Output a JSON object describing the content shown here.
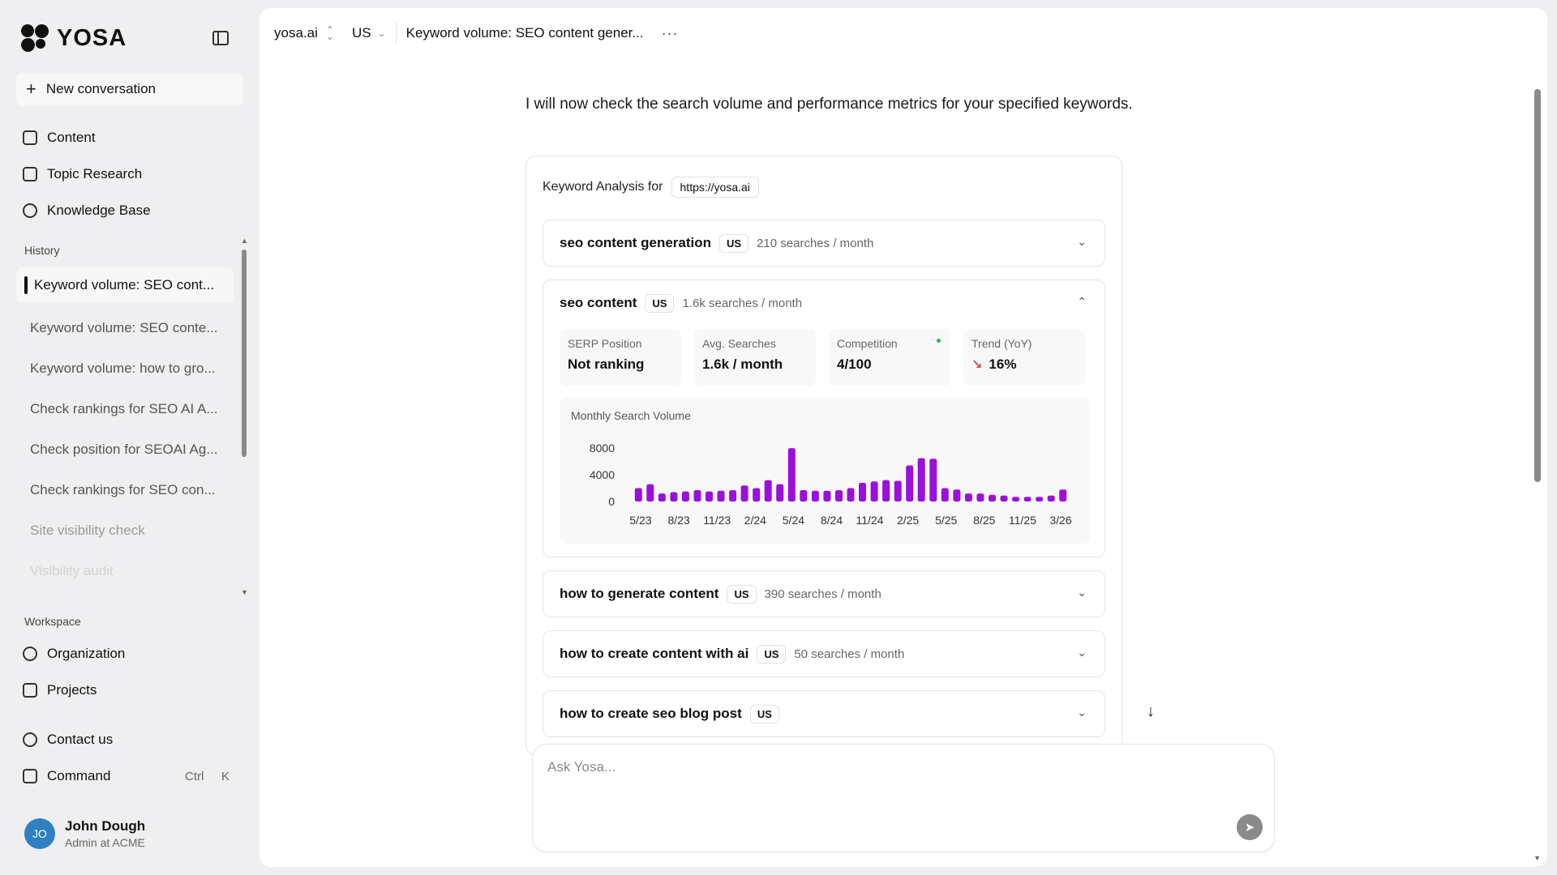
{
  "brand": {
    "name": "YOSA"
  },
  "sidebar": {
    "new_conversation": "New conversation",
    "nav": [
      {
        "label": "Content",
        "icon": "content-icon"
      },
      {
        "label": "Topic Research",
        "icon": "topic-research-icon"
      },
      {
        "label": "Knowledge Base",
        "icon": "knowledge-base-icon"
      }
    ],
    "history_label": "History",
    "history": [
      "Keyword volume: SEO cont...",
      "Keyword volume: SEO conte...",
      "Keyword volume: how to gro...",
      "Check rankings for SEO AI A...",
      "Check position for SEOAI Ag...",
      "Check rankings for SEO con...",
      "Site visibility check",
      "Visibility audit"
    ],
    "workspace_label": "Workspace",
    "workspace": [
      {
        "label": "Organization",
        "icon": "organization-icon"
      },
      {
        "label": "Projects",
        "icon": "projects-icon"
      }
    ],
    "contact": "Contact us",
    "command": "Command",
    "shortcut_ctrl": "Ctrl",
    "shortcut_key": "K",
    "user": {
      "initials": "JO",
      "name": "John Dough",
      "role": "Admin at ACME"
    }
  },
  "topbar": {
    "site": "yosa.ai",
    "country": "US",
    "title": "Keyword volume: SEO content gener...",
    "more": "···"
  },
  "main": {
    "intro": "I will now check the search volume and performance metrics for your specified keywords.",
    "analysis_label": "Keyword Analysis for",
    "analysis_url": "https://yosa.ai",
    "keywords": [
      {
        "name": "seo content generation",
        "country": "US",
        "volume": "210 searches / month",
        "expanded": false
      },
      {
        "name": "seo content",
        "country": "US",
        "volume": "1.6k searches / month",
        "expanded": true
      },
      {
        "name": "how to generate content",
        "country": "US",
        "volume": "390 searches / month",
        "expanded": false
      },
      {
        "name": "how to create content with ai",
        "country": "US",
        "volume": "50 searches / month",
        "expanded": false
      },
      {
        "name": "how to create seo blog post",
        "country": "US",
        "volume": "",
        "expanded": false
      }
    ],
    "metrics": [
      {
        "label": "SERP Position",
        "value": "Not ranking"
      },
      {
        "label": "Avg. Searches",
        "value": "1.6k / month"
      },
      {
        "label": "Competition",
        "value": "4/100"
      },
      {
        "label": "Trend (YoY)",
        "value": "16%"
      }
    ]
  },
  "ask": {
    "placeholder": "Ask Yosa..."
  },
  "colors": {
    "accent": "#9b0fdc",
    "trend_down": "#e0434b",
    "competition_dot": "#1db954"
  },
  "chart_data": {
    "type": "bar",
    "title": "Monthly Search Volume",
    "yticks": [
      0,
      4000,
      8000
    ],
    "ylim": [
      0,
      8500
    ],
    "xticks": [
      "5/23",
      "8/23",
      "11/23",
      "2/24",
      "5/24",
      "8/24",
      "11/24",
      "2/25",
      "5/25",
      "8/25",
      "11/25",
      "3/26"
    ],
    "values": [
      2000,
      2600,
      1200,
      1400,
      1500,
      1700,
      1500,
      1600,
      1700,
      2400,
      2000,
      3200,
      2600,
      8000,
      1700,
      1600,
      1600,
      1700,
      2000,
      2800,
      3000,
      3200,
      3100,
      5400,
      6500,
      6400,
      2000,
      1800,
      1200,
      1200,
      1000,
      900,
      700,
      700,
      700,
      900,
      1800
    ]
  }
}
